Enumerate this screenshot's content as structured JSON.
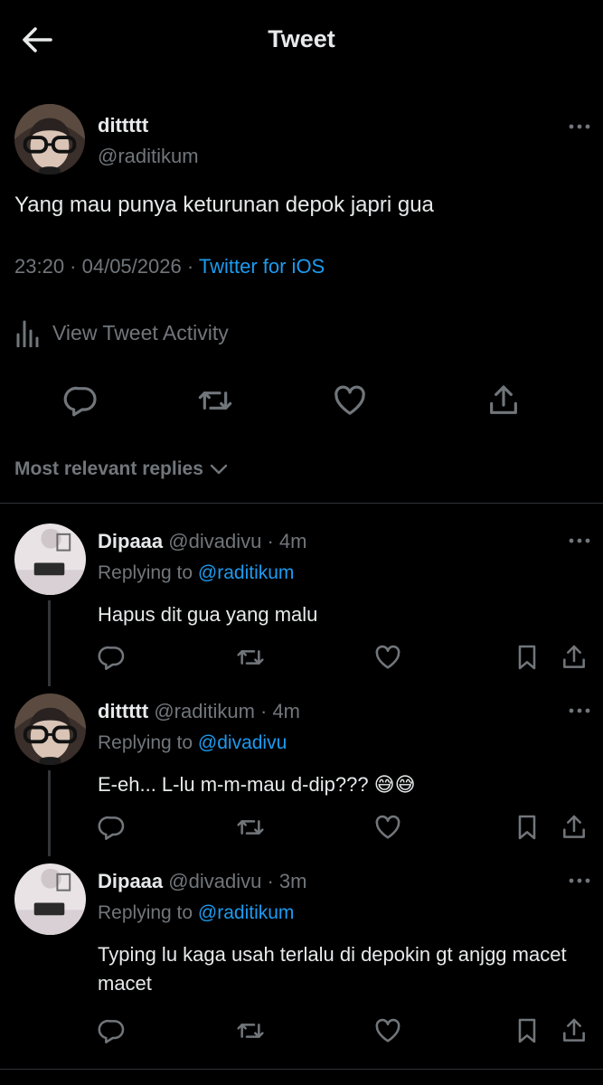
{
  "header": {
    "title": "Tweet",
    "back_icon": "arrow-left-icon"
  },
  "tweet": {
    "display_name": "dittttt",
    "handle": "@raditikum",
    "text": "Yang mau punya keturunan depok japri gua",
    "time_date": "23:20 · 04/05/2026 · ",
    "source": "Twitter for iOS",
    "activity_label": "View Tweet Activity"
  },
  "sort": {
    "label": "Most relevant replies"
  },
  "replies": [
    {
      "display_name": "Dipaaa",
      "meta": "@divadivu · 4m",
      "replying_prefix": "Replying to ",
      "replying_to": "@raditikum",
      "text": "Hapus dit gua yang malu"
    },
    {
      "display_name": "dittttt",
      "meta": "@raditikum · 4m",
      "replying_prefix": "Replying to ",
      "replying_to": "@divadivu",
      "text": "E-eh... L-lu m-m-mau d-dip??? 😅😅"
    },
    {
      "display_name": "Dipaaa",
      "meta": "@divadivu · 3m",
      "replying_prefix": "Replying to ",
      "replying_to": "@raditikum",
      "text": "Typing lu kaga usah terlalu di depokin gt anjgg macet macet"
    }
  ],
  "colors": {
    "background": "#000000",
    "text": "#e7e9ea",
    "muted": "#71767b",
    "link": "#1d9bf0",
    "divider": "#2f3336"
  }
}
